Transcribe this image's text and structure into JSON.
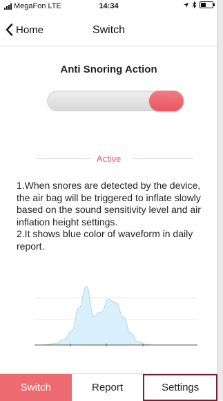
{
  "status_bar": {
    "carrier": "MegaFon",
    "network": "LTE",
    "time": "14:34",
    "right_icons": [
      "location-arrow-icon",
      "bluetooth-icon",
      "battery-icon"
    ]
  },
  "nav": {
    "back_label": "Home",
    "title": "Switch"
  },
  "main": {
    "section_title": "Anti Snoring Action",
    "toggle": {
      "on": true,
      "color": "#ea5a65"
    },
    "status_text": "Active",
    "description": [
      "1.When snores are detected by the device, the air bag will be triggered to inflate slowly based on the sound sensitivity level and air inflation height settings.",
      "2.It shows blue color of waveform in daily report."
    ]
  },
  "waveform": {
    "color": "#bfe3f7",
    "values": [
      0,
      0,
      0.01,
      0.03,
      0.09,
      0.22,
      0.58,
      0.92,
      0.45,
      0.52,
      0.72,
      0.66,
      0.44,
      0.18,
      0.05,
      0.01,
      0,
      0,
      0,
      0,
      0,
      0,
      0
    ]
  },
  "tabs": [
    {
      "label": "Switch",
      "active": true
    },
    {
      "label": "Report",
      "active": false
    },
    {
      "label": "Settings",
      "active": false
    }
  ],
  "colors": {
    "accent": "#ec6a70",
    "settings_border": "#7b1d2c"
  }
}
